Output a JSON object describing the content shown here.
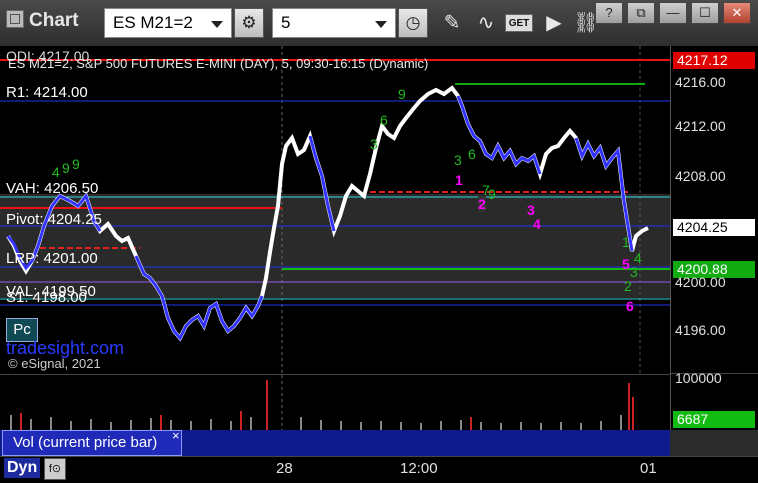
{
  "toolbar": {
    "app_title": "Chart",
    "symbol": "ES M21=2",
    "interval": "5",
    "get_label": "GET"
  },
  "window_controls": [
    "?",
    "⧉",
    "—",
    "☐",
    "✕"
  ],
  "chart": {
    "header": "ES M21=2, S&P 500 FUTURES E-MINI (DAY), 5, 09:30-16:15 (Dynamic)",
    "header_partial": "ODI: 4217.00",
    "watermark_brand": "tradesight.com",
    "watermark_copyright": "© eSignal, 2021",
    "pc_button": "Pc",
    "levels": [
      {
        "label": "R1: 4214.00",
        "price": 4214.0,
        "color": "#3344ff"
      },
      {
        "label": "VAH: 4206.50",
        "price": 4206.5,
        "color": "#33dddd"
      },
      {
        "label": "Pivot: 4204.25",
        "price": 4204.25,
        "color": "#3344ff"
      },
      {
        "label": "LRP: 4201.00",
        "price": 4201.0,
        "color": "#3344ff"
      },
      {
        "label": "VAL: 4199.50",
        "price": 4199.5,
        "color": "#aa55ff"
      },
      {
        "label": "S1: 4198.00",
        "price": 4198.0,
        "color": "#3344ff"
      }
    ],
    "seq_labels_green": [
      "1",
      "2",
      "3",
      "4",
      "5",
      "6",
      "7",
      "8",
      "9"
    ],
    "seq_labels_magenta": [
      "1",
      "2",
      "3",
      "4",
      "5",
      "6"
    ]
  },
  "price_axis": {
    "ticks": [
      "4216.00",
      "4212.00",
      "4208.00",
      "4204.00",
      "4200.00",
      "4196.00"
    ],
    "tag_high": {
      "text": "4217.12",
      "color": "#e00000"
    },
    "tag_last": {
      "text": "4204.25",
      "color": "#ffffff"
    },
    "tag_low": {
      "text": "4200.88",
      "color": "#11aa11"
    },
    "vol_tick": "100000",
    "vol_tag": {
      "text": "6687",
      "color": "#11bb11"
    }
  },
  "volume_panel": {
    "tab_label": "Vol (current price bar)",
    "close_label": "×"
  },
  "time_axis": {
    "labels": [
      "28",
      "12:00",
      "01"
    ],
    "dyn_label": "Dyn",
    "f_button": "f⊙"
  }
}
